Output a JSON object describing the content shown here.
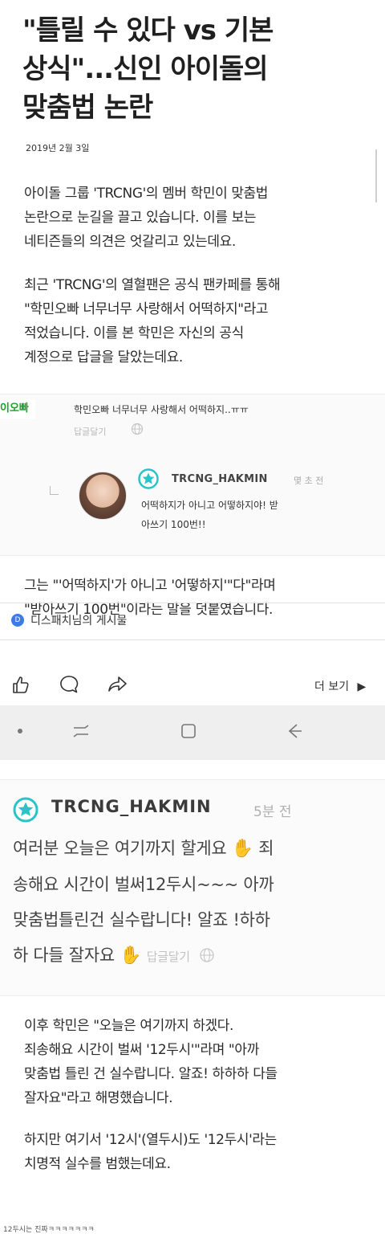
{
  "article": {
    "headline_lines": [
      "\"틀릴 수 있다 vs 기본",
      "상식\"...신인 아이돌의",
      "맞춤법 논란"
    ],
    "date": "2019년 2월 3일",
    "paragraphs": [
      [
        "아이돌 그룹 'TRCNG'의 멤버 학민이 맞춤법",
        "논란으로 눈길을 끌고 있습니다. 이를 보는",
        "네티즌들의 의견은 엇갈리고 있는데요."
      ],
      [
        "최근 'TRCNG'의 열혈팬은 공식 팬카페를 통해",
        "\"학민오빠 너무너무 사랑해서 어떡하지\"라고",
        "적었습니다. 이를 본 학민은 자신의 공식",
        "계정으로 답글을 달았는데요."
      ],
      [
        "그는 \"'어떡하지'가 아니고 '어떻하지'\"다\"라며",
        "\"받아쓰기 100번\"이라는 말을 덧붙였습니다."
      ],
      [
        "이후 학민은 \"오늘은 여기까지 하겠다.",
        "죄송해요 시간이 벌써 '12두시'\"라며 \"아까",
        "맞춤법 틀린 건 실수랍니다. 알죠! 하하하 다들",
        "잘자요\"라고 해명했습니다."
      ],
      [
        "하지만 여기서 '12시'(열두시)도 '12두시'라는",
        "치명적 실수를 범했는데요."
      ]
    ]
  },
  "embed_small": {
    "avatar_snippet": "이오빠",
    "fan_comment": "학민오빠 너무너무 사랑해서 어떡하지..ㅠㅠ",
    "reply_action": "답글달기",
    "username": "TRCNG_HAKMIN",
    "time": "몇 초 전",
    "reply_lines": [
      "어떡하지가 아니고 어떻하지야! 받",
      "아쓰기 100번!!"
    ]
  },
  "post": {
    "author_icon": "D",
    "author": "디스패치님의 게시물",
    "more_label": "더 보기",
    "more_arrow": "▶"
  },
  "embed_large": {
    "username": "TRCNG_HAKMIN",
    "time": "5분 전",
    "lines": [
      "여러분 오늘은 여기까지 할게요",
      "송해요 시간이 벌써12두시~~~ 아까",
      "맞춤법틀린건 실수랍니다! 알죠 !하하",
      "하 다들 잘자요"
    ],
    "line1_tail": " 죄",
    "reply_action": "답글달기",
    "wave_glyph": "✋"
  },
  "footer_note": "12두시는 진짜ㅋㅋㅋㅋㅋㅋㅋ",
  "colors": {
    "star_badge": "#29c4c8",
    "post_icon": "#3d7be0",
    "nav_bg": "#efefef"
  }
}
